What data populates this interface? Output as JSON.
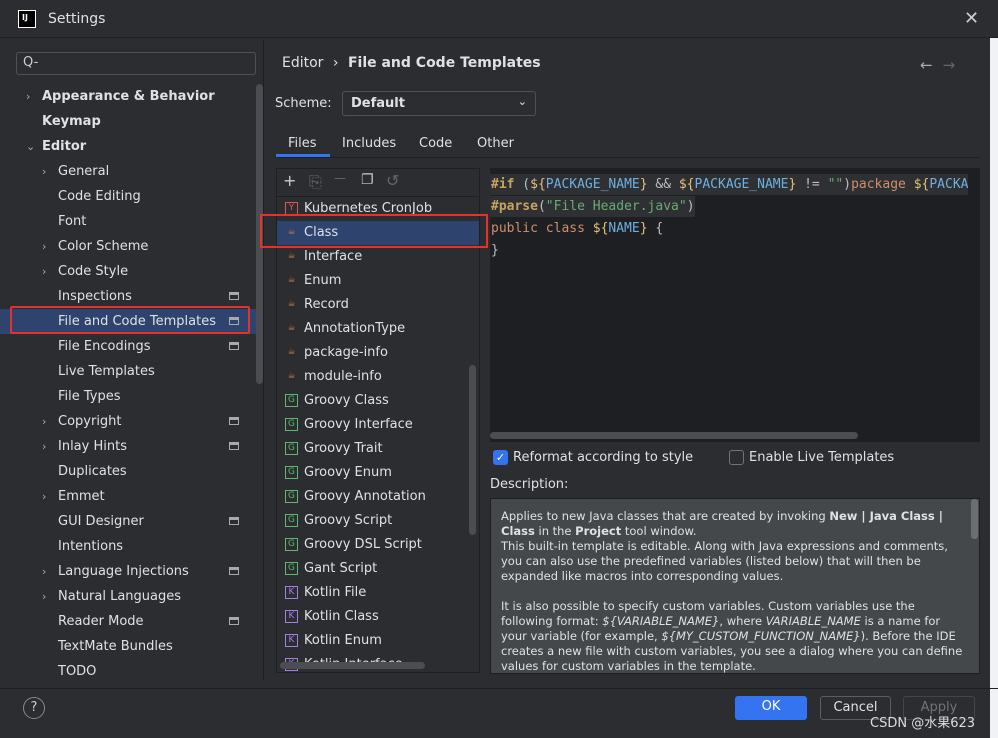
{
  "window": {
    "title": "Settings",
    "icon": "intellij-icon",
    "icon_text": "IJ"
  },
  "search": {
    "placeholder": "Q-"
  },
  "sidebar": {
    "items": [
      {
        "label": "Appearance & Behavior",
        "level": 0,
        "arrow": "›",
        "bold": true
      },
      {
        "label": "Keymap",
        "level": 0,
        "bold": true
      },
      {
        "label": "Editor",
        "level": 0,
        "arrow": "⌄",
        "bold": true
      },
      {
        "label": "General",
        "level": 1,
        "arrow": "›"
      },
      {
        "label": "Code Editing",
        "level": 1
      },
      {
        "label": "Font",
        "level": 1
      },
      {
        "label": "Color Scheme",
        "level": 1,
        "arrow": "›"
      },
      {
        "label": "Code Style",
        "level": 1,
        "arrow": "›"
      },
      {
        "label": "Inspections",
        "level": 1,
        "badge": true
      },
      {
        "label": "File and Code Templates",
        "level": 1,
        "badge": true,
        "selected": true
      },
      {
        "label": "File Encodings",
        "level": 1,
        "badge": true
      },
      {
        "label": "Live Templates",
        "level": 1
      },
      {
        "label": "File Types",
        "level": 1
      },
      {
        "label": "Copyright",
        "level": 1,
        "arrow": "›",
        "badge": true
      },
      {
        "label": "Inlay Hints",
        "level": 1,
        "arrow": "›",
        "badge": true
      },
      {
        "label": "Duplicates",
        "level": 1
      },
      {
        "label": "Emmet",
        "level": 1,
        "arrow": "›"
      },
      {
        "label": "GUI Designer",
        "level": 1,
        "badge": true
      },
      {
        "label": "Intentions",
        "level": 1
      },
      {
        "label": "Language Injections",
        "level": 1,
        "arrow": "›",
        "badge": true
      },
      {
        "label": "Natural Languages",
        "level": 1,
        "arrow": "›"
      },
      {
        "label": "Reader Mode",
        "level": 1,
        "badge": true
      },
      {
        "label": "TextMate Bundles",
        "level": 1
      },
      {
        "label": "TODO",
        "level": 1
      }
    ]
  },
  "breadcrumb": {
    "parent": "Editor",
    "separator": "›",
    "current": "File and Code Templates",
    "back": "←",
    "forward": "→"
  },
  "scheme": {
    "label": "Scheme:",
    "value": "Default"
  },
  "tabs": [
    {
      "label": "Files",
      "active": true
    },
    {
      "label": "Includes"
    },
    {
      "label": "Code"
    },
    {
      "label": "Other"
    }
  ],
  "templates": [
    {
      "label": "Kubernetes CronJob",
      "icon": "yaml",
      "glyph": "Y"
    },
    {
      "label": "Class",
      "icon": "java",
      "glyph": "☕",
      "selected": true
    },
    {
      "label": "Interface",
      "icon": "java",
      "glyph": "☕"
    },
    {
      "label": "Enum",
      "icon": "java",
      "glyph": "☕"
    },
    {
      "label": "Record",
      "icon": "java",
      "glyph": "☕"
    },
    {
      "label": "AnnotationType",
      "icon": "java",
      "glyph": "☕"
    },
    {
      "label": "package-info",
      "icon": "java",
      "glyph": "☕"
    },
    {
      "label": "module-info",
      "icon": "java",
      "glyph": "☕"
    },
    {
      "label": "Groovy Class",
      "icon": "groovy",
      "glyph": "G"
    },
    {
      "label": "Groovy Interface",
      "icon": "groovy",
      "glyph": "G"
    },
    {
      "label": "Groovy Trait",
      "icon": "groovy",
      "glyph": "G"
    },
    {
      "label": "Groovy Enum",
      "icon": "groovy",
      "glyph": "G"
    },
    {
      "label": "Groovy Annotation",
      "icon": "groovy",
      "glyph": "G"
    },
    {
      "label": "Groovy Script",
      "icon": "groovy",
      "glyph": "G"
    },
    {
      "label": "Groovy DSL Script",
      "icon": "groovy",
      "glyph": "G"
    },
    {
      "label": "Gant Script",
      "icon": "groovy",
      "glyph": "G"
    },
    {
      "label": "Kotlin File",
      "icon": "kotlin",
      "glyph": "K"
    },
    {
      "label": "Kotlin Class",
      "icon": "kotlin",
      "glyph": "K"
    },
    {
      "label": "Kotlin Enum",
      "icon": "kotlin",
      "glyph": "K"
    },
    {
      "label": "Kotlin Interface",
      "icon": "kotlin",
      "glyph": "K"
    }
  ],
  "toolbar": {
    "add": "+",
    "copy": "⎘",
    "remove": "—",
    "duplicate": "❐",
    "reset": "↺"
  },
  "code": [
    [
      [
        "dir",
        "#if"
      ],
      [
        "pl",
        " ("
      ],
      [
        "dol",
        "${"
      ],
      [
        "var",
        "PACKAGE_NAME"
      ],
      [
        "dol",
        "}"
      ],
      [
        "pl",
        " && "
      ],
      [
        "dol",
        "${"
      ],
      [
        "var",
        "PACKAGE_NAME"
      ],
      [
        "dol",
        "}"
      ],
      [
        "pl",
        " != "
      ],
      [
        "str",
        "\"\""
      ],
      [
        "pl",
        ")"
      ],
      [
        "kw",
        "package "
      ],
      [
        "dol",
        "${"
      ],
      [
        "var",
        "PACKA"
      ]
    ],
    [
      [
        "dir",
        "#parse"
      ],
      [
        "pl",
        "("
      ],
      [
        "str",
        "\"File Header.java\""
      ],
      [
        "pl",
        ")"
      ]
    ],
    [
      [
        "kw",
        "public class "
      ],
      [
        "dol",
        "${"
      ],
      [
        "var",
        "NAME"
      ],
      [
        "dol",
        "}"
      ],
      [
        "pl",
        " {"
      ]
    ],
    [
      [
        "pl",
        "}"
      ]
    ]
  ],
  "options": {
    "reformat": {
      "label": "Reformat according to style",
      "checked": true
    },
    "live_templates": {
      "label": "Enable Live Templates",
      "checked": false
    }
  },
  "description": {
    "label": "Description:",
    "paragraphs": [
      [
        [
          "n",
          "Applies to new Java classes that are created by invoking "
        ],
        [
          "b",
          "New | Java Class | Class"
        ],
        [
          "n",
          " in the "
        ],
        [
          "b",
          "Project"
        ],
        [
          "n",
          " tool window."
        ],
        [
          "br",
          ""
        ],
        [
          "n",
          "This built-in template is editable. Along with Java expressions and comments, you can also use the predefined variables (listed below) that will then be expanded like macros into corresponding values."
        ]
      ],
      [
        [
          "n",
          "It is also possible to specify custom variables. Custom variables use the following format: "
        ],
        [
          "i",
          "${VARIABLE_NAME}"
        ],
        [
          "n",
          ", where "
        ],
        [
          "i",
          "VARIABLE_NAME"
        ],
        [
          "n",
          " is a name for your variable (for example, "
        ],
        [
          "i",
          "${MY_CUSTOM_FUNCTION_NAME}"
        ],
        [
          "n",
          "). Before the IDE creates a new file with custom variables, you see a dialog where you can define values for custom variables in the template."
        ]
      ]
    ]
  },
  "buttons": {
    "help": "?",
    "ok": "OK",
    "cancel": "Cancel",
    "apply": "Apply"
  },
  "watermark": "CSDN @水果623",
  "colors": {
    "accent": "#3574f0",
    "selection": "#2e436e",
    "highlight_outline": "#e5322d"
  }
}
